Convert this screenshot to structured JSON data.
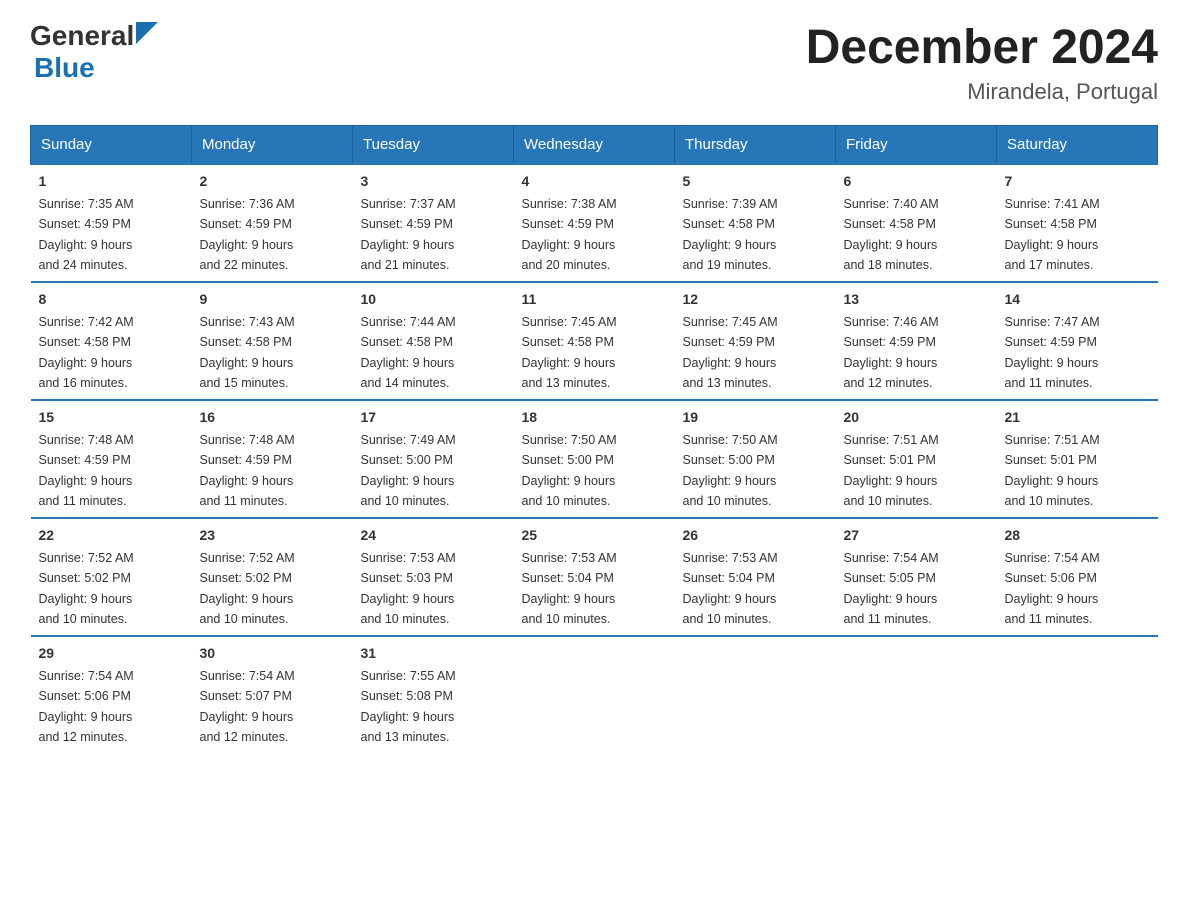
{
  "header": {
    "logo_general": "General",
    "logo_blue": "Blue",
    "title": "December 2024",
    "subtitle": "Mirandela, Portugal"
  },
  "days_of_week": [
    "Sunday",
    "Monday",
    "Tuesday",
    "Wednesday",
    "Thursday",
    "Friday",
    "Saturday"
  ],
  "weeks": [
    [
      {
        "num": "1",
        "sunrise": "7:35 AM",
        "sunset": "4:59 PM",
        "daylight": "9 hours and 24 minutes."
      },
      {
        "num": "2",
        "sunrise": "7:36 AM",
        "sunset": "4:59 PM",
        "daylight": "9 hours and 22 minutes."
      },
      {
        "num": "3",
        "sunrise": "7:37 AM",
        "sunset": "4:59 PM",
        "daylight": "9 hours and 21 minutes."
      },
      {
        "num": "4",
        "sunrise": "7:38 AM",
        "sunset": "4:59 PM",
        "daylight": "9 hours and 20 minutes."
      },
      {
        "num": "5",
        "sunrise": "7:39 AM",
        "sunset": "4:58 PM",
        "daylight": "9 hours and 19 minutes."
      },
      {
        "num": "6",
        "sunrise": "7:40 AM",
        "sunset": "4:58 PM",
        "daylight": "9 hours and 18 minutes."
      },
      {
        "num": "7",
        "sunrise": "7:41 AM",
        "sunset": "4:58 PM",
        "daylight": "9 hours and 17 minutes."
      }
    ],
    [
      {
        "num": "8",
        "sunrise": "7:42 AM",
        "sunset": "4:58 PM",
        "daylight": "9 hours and 16 minutes."
      },
      {
        "num": "9",
        "sunrise": "7:43 AM",
        "sunset": "4:58 PM",
        "daylight": "9 hours and 15 minutes."
      },
      {
        "num": "10",
        "sunrise": "7:44 AM",
        "sunset": "4:58 PM",
        "daylight": "9 hours and 14 minutes."
      },
      {
        "num": "11",
        "sunrise": "7:45 AM",
        "sunset": "4:58 PM",
        "daylight": "9 hours and 13 minutes."
      },
      {
        "num": "12",
        "sunrise": "7:45 AM",
        "sunset": "4:59 PM",
        "daylight": "9 hours and 13 minutes."
      },
      {
        "num": "13",
        "sunrise": "7:46 AM",
        "sunset": "4:59 PM",
        "daylight": "9 hours and 12 minutes."
      },
      {
        "num": "14",
        "sunrise": "7:47 AM",
        "sunset": "4:59 PM",
        "daylight": "9 hours and 11 minutes."
      }
    ],
    [
      {
        "num": "15",
        "sunrise": "7:48 AM",
        "sunset": "4:59 PM",
        "daylight": "9 hours and 11 minutes."
      },
      {
        "num": "16",
        "sunrise": "7:48 AM",
        "sunset": "4:59 PM",
        "daylight": "9 hours and 11 minutes."
      },
      {
        "num": "17",
        "sunrise": "7:49 AM",
        "sunset": "5:00 PM",
        "daylight": "9 hours and 10 minutes."
      },
      {
        "num": "18",
        "sunrise": "7:50 AM",
        "sunset": "5:00 PM",
        "daylight": "9 hours and 10 minutes."
      },
      {
        "num": "19",
        "sunrise": "7:50 AM",
        "sunset": "5:00 PM",
        "daylight": "9 hours and 10 minutes."
      },
      {
        "num": "20",
        "sunrise": "7:51 AM",
        "sunset": "5:01 PM",
        "daylight": "9 hours and 10 minutes."
      },
      {
        "num": "21",
        "sunrise": "7:51 AM",
        "sunset": "5:01 PM",
        "daylight": "9 hours and 10 minutes."
      }
    ],
    [
      {
        "num": "22",
        "sunrise": "7:52 AM",
        "sunset": "5:02 PM",
        "daylight": "9 hours and 10 minutes."
      },
      {
        "num": "23",
        "sunrise": "7:52 AM",
        "sunset": "5:02 PM",
        "daylight": "9 hours and 10 minutes."
      },
      {
        "num": "24",
        "sunrise": "7:53 AM",
        "sunset": "5:03 PM",
        "daylight": "9 hours and 10 minutes."
      },
      {
        "num": "25",
        "sunrise": "7:53 AM",
        "sunset": "5:04 PM",
        "daylight": "9 hours and 10 minutes."
      },
      {
        "num": "26",
        "sunrise": "7:53 AM",
        "sunset": "5:04 PM",
        "daylight": "9 hours and 10 minutes."
      },
      {
        "num": "27",
        "sunrise": "7:54 AM",
        "sunset": "5:05 PM",
        "daylight": "9 hours and 11 minutes."
      },
      {
        "num": "28",
        "sunrise": "7:54 AM",
        "sunset": "5:06 PM",
        "daylight": "9 hours and 11 minutes."
      }
    ],
    [
      {
        "num": "29",
        "sunrise": "7:54 AM",
        "sunset": "5:06 PM",
        "daylight": "9 hours and 12 minutes."
      },
      {
        "num": "30",
        "sunrise": "7:54 AM",
        "sunset": "5:07 PM",
        "daylight": "9 hours and 12 minutes."
      },
      {
        "num": "31",
        "sunrise": "7:55 AM",
        "sunset": "5:08 PM",
        "daylight": "9 hours and 13 minutes."
      },
      null,
      null,
      null,
      null
    ]
  ],
  "labels": {
    "sunrise": "Sunrise:",
    "sunset": "Sunset:",
    "daylight": "Daylight:"
  }
}
